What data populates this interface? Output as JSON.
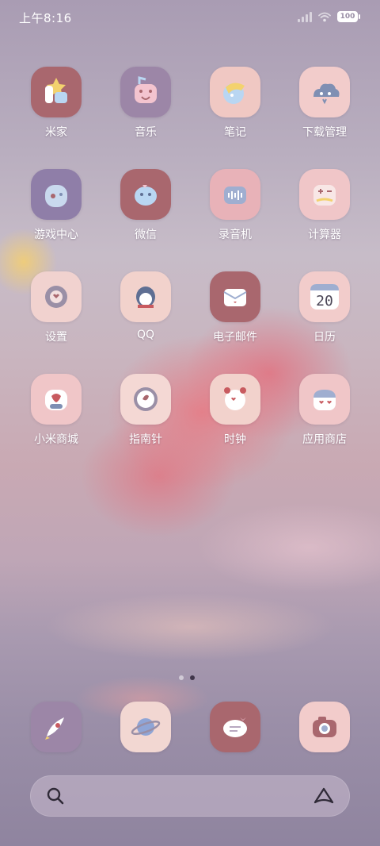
{
  "status_bar": {
    "time": "上午8:16",
    "battery": "100"
  },
  "apps": [
    {
      "label": "米家",
      "icon": "mijia-icon",
      "bg": "#a9676e"
    },
    {
      "label": "音乐",
      "icon": "music-icon",
      "bg": "#9c86a7"
    },
    {
      "label": "笔记",
      "icon": "notes-icon",
      "bg": "#f0c8c3"
    },
    {
      "label": "下载管理",
      "icon": "download-manager-icon",
      "bg": "#f2cccb"
    },
    {
      "label": "游戏中心",
      "icon": "game-center-icon",
      "bg": "#8f7ea8"
    },
    {
      "label": "微信",
      "icon": "wechat-icon",
      "bg": "#a9676e"
    },
    {
      "label": "录音机",
      "icon": "recorder-icon",
      "bg": "#e8b2b8"
    },
    {
      "label": "计算器",
      "icon": "calculator-icon",
      "bg": "#f0c6c8"
    },
    {
      "label": "设置",
      "icon": "settings-icon",
      "bg": "#f1d2cf"
    },
    {
      "label": "QQ",
      "icon": "qq-icon",
      "bg": "#f2d2cc"
    },
    {
      "label": "电子邮件",
      "icon": "email-icon",
      "bg": "#a9676e"
    },
    {
      "label": "日历",
      "icon": "calendar-icon",
      "bg": "#f2cccb",
      "text": "20"
    },
    {
      "label": "小米商城",
      "icon": "mi-store-icon",
      "bg": "#f0c6c8"
    },
    {
      "label": "指南针",
      "icon": "compass-icon",
      "bg": "#f4d8d4"
    },
    {
      "label": "时钟",
      "icon": "clock-icon",
      "bg": "#f2d2cc"
    },
    {
      "label": "应用商店",
      "icon": "app-store-icon",
      "bg": "#f0c6c8"
    }
  ],
  "page_indicator": {
    "count": 2,
    "active": 2
  },
  "dock": [
    {
      "icon": "rocket-icon",
      "bg": "#9c86a7"
    },
    {
      "icon": "browser-planet-icon",
      "bg": "#f2d7d2"
    },
    {
      "icon": "messages-icon",
      "bg": "#a9676e"
    },
    {
      "icon": "camera-icon",
      "bg": "#f2cccb"
    }
  ],
  "search": {
    "search_icon": "search-icon",
    "assistant_icon": "assistant-icon"
  }
}
